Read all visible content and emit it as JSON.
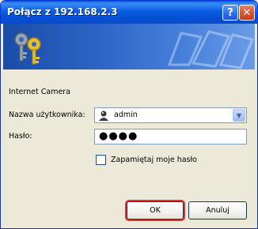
{
  "window": {
    "title": "Połącz z 192.168.2.3",
    "help_label": "?",
    "close_label": "X"
  },
  "dialog": {
    "site_label": "Internet Camera",
    "username_label": "Nazwa użytkownika:",
    "username_value": "admin",
    "password_label": "Hasło:",
    "password_value": "●●●●",
    "remember_label": "Zapamiętaj moje hasło",
    "remember_checked": false,
    "ok_label": "OK",
    "cancel_label": "Anuluj"
  },
  "icons": [
    "keys-icon",
    "user-icon",
    "chevron-down-icon"
  ]
}
